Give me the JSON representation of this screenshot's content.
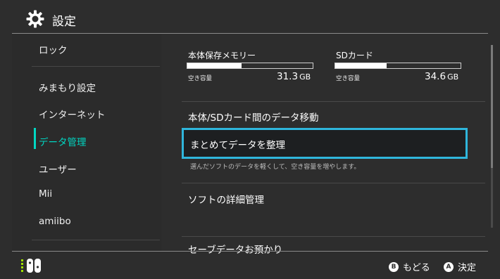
{
  "header": {
    "title": "設定",
    "icon": "gear-icon"
  },
  "sidebar": {
    "items": [
      {
        "label": "ロック"
      },
      {
        "label": "みまもり設定"
      },
      {
        "label": "インターネット"
      },
      {
        "label": "データ管理",
        "active": true
      },
      {
        "label": "ユーザー"
      },
      {
        "label": "Mii"
      },
      {
        "label": "amiibo"
      }
    ]
  },
  "storage": {
    "system": {
      "label": "本体保存メモリー",
      "free_label": "空き容量",
      "free_value": "31.3",
      "unit": "GB",
      "used_fraction": 0.43
    },
    "sd": {
      "label": "SDカード",
      "free_label": "空き容量",
      "free_value": "34.6",
      "unit": "GB",
      "used_fraction": 0.41
    }
  },
  "main": {
    "items": [
      {
        "label": "本体/SDカード間のデータ移動"
      },
      {
        "label": "まとめてデータを整理",
        "selected": true,
        "description": "選んだソフトのデータを軽くして、空き容量を増やします。"
      },
      {
        "label": "ソフトの詳細管理"
      },
      {
        "label": "セーブデータお預かり"
      }
    ]
  },
  "footer": {
    "back": {
      "button": "B",
      "label": "もどる"
    },
    "confirm": {
      "button": "A",
      "label": "決定"
    }
  },
  "colors": {
    "accent": "#00d7c3",
    "selection_border": "#2fb6dc",
    "background": "#2d2d2d"
  }
}
